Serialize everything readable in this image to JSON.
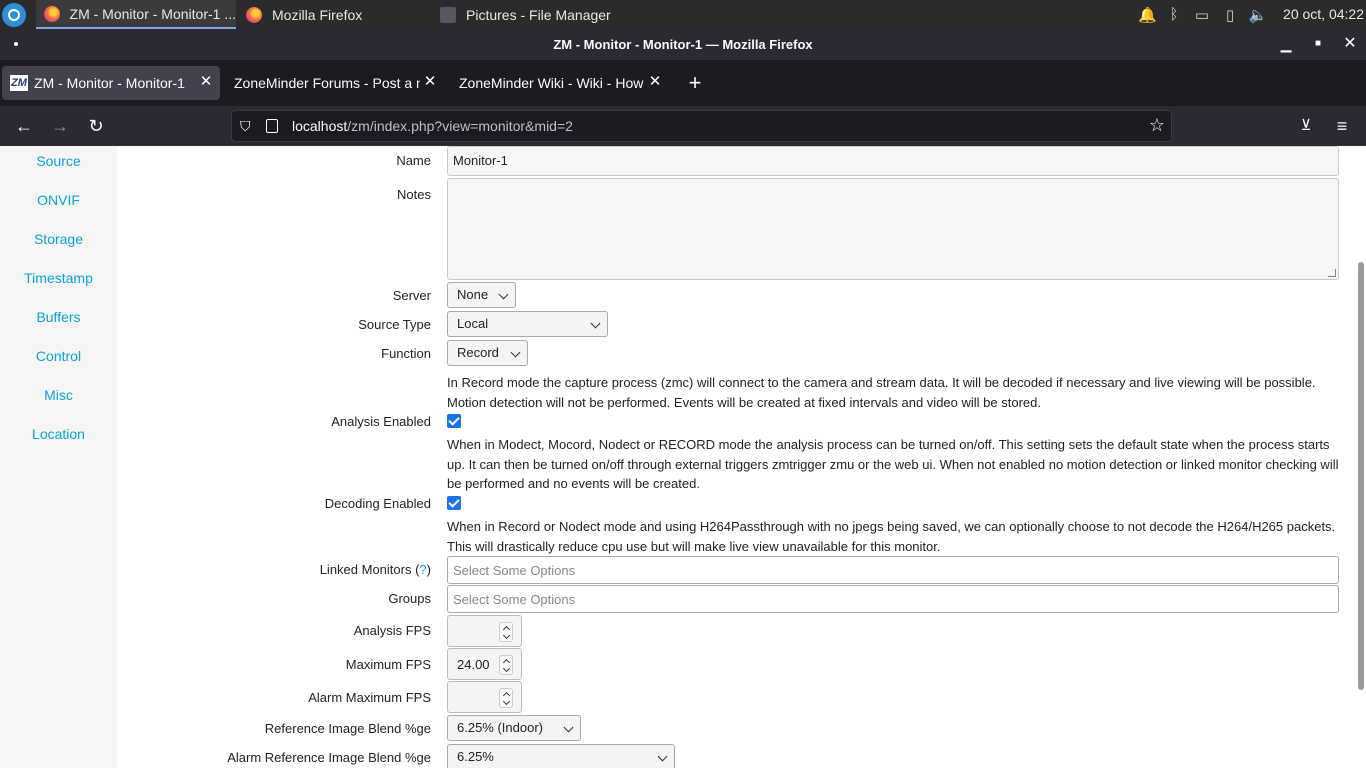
{
  "taskbar": {
    "tasks": [
      {
        "label": "ZM - Monitor - Monitor-1 ..."
      },
      {
        "label": "Mozilla Firefox"
      },
      {
        "label": "Pictures - File Manager"
      }
    ],
    "clock": "20 oct, 04:22"
  },
  "window": {
    "title": "ZM - Monitor - Monitor-1 — Mozilla Firefox"
  },
  "tabs": [
    {
      "label": "ZM - Monitor - Monitor-1",
      "favicon": "ZM"
    },
    {
      "label": "ZoneMinder Forums - Post a n"
    },
    {
      "label": "ZoneMinder Wiki - Wiki - How t"
    }
  ],
  "urlbar": {
    "host": "localhost",
    "path": "/zm/index.php?view=monitor&mid=2"
  },
  "sidebar": {
    "items": [
      "Source",
      "ONVIF",
      "Storage",
      "Timestamp",
      "Buffers",
      "Control",
      "Misc",
      "Location"
    ]
  },
  "form": {
    "name": {
      "label": "Name",
      "value": "Monitor-1"
    },
    "notes": {
      "label": "Notes",
      "value": ""
    },
    "server": {
      "label": "Server",
      "value": "None"
    },
    "source_type": {
      "label": "Source Type",
      "value": "Local"
    },
    "function": {
      "label": "Function",
      "value": "Record",
      "help_line1": "In Record mode the capture process (zmc) will connect to the camera and stream data. It will be decoded if necessary and live viewing will be possible.",
      "help_line2": "Motion detection will not be performed. Events will be created at fixed intervals and video will be stored."
    },
    "analysis_enabled": {
      "label": "Analysis Enabled",
      "checked": true,
      "help_line1": "When in Modect, Mocord, Nodect or RECORD mode the analysis process can be turned on/off. This setting sets the default state when the process starts",
      "help_line2": "up. It can then be turned on/off through external triggers zmtrigger zmu or the web ui. When not enabled no motion detection or linked monitor checking will",
      "help_line3": "be performed and no events will be created."
    },
    "decoding_enabled": {
      "label": "Decoding Enabled",
      "checked": true,
      "help_line1": "When in Record or Nodect mode and using H264Passthrough with no jpegs being saved, we can optionally choose to not decode the H264/H265 packets.",
      "help_line2": "This will drastically reduce cpu use but will make live view unavailable for this monitor."
    },
    "linked_monitors": {
      "label": "Linked Monitors (",
      "help_link": "?",
      "label_end": ")",
      "placeholder": "Select Some Options"
    },
    "groups": {
      "label": "Groups",
      "placeholder": "Select Some Options"
    },
    "analysis_fps": {
      "label": "Analysis FPS",
      "value": ""
    },
    "maximum_fps": {
      "label": "Maximum FPS",
      "value": "24.00"
    },
    "alarm_maximum_fps": {
      "label": "Alarm Maximum FPS",
      "value": ""
    },
    "ref_blend": {
      "label": "Reference Image Blend %ge",
      "value": "6.25% (Indoor)"
    },
    "alarm_ref_blend": {
      "label": "Alarm Reference Image Blend %ge",
      "value": "6.25%"
    }
  }
}
